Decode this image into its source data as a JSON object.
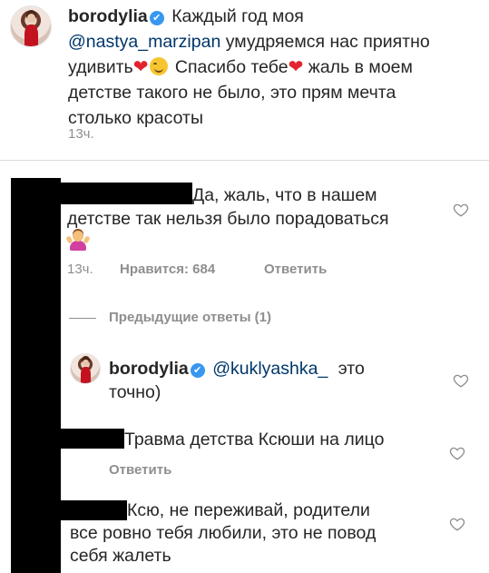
{
  "caption": {
    "username": "borodylia",
    "verified_glyph": "✔",
    "line1_text": "Каждый год моя",
    "mention": "@nastya_marzipan",
    "line2_after_mention": "умудряемся нас приятно",
    "line3_a": "удивить",
    "line3_b": "Спасибо тебе",
    "line3_c": "жаль в моем",
    "line4": "детстве такого не было, это прям мечта",
    "line5": "столько красоты",
    "time": "13ч."
  },
  "comment1": {
    "line1": "Да, жаль, что в нашем",
    "line2": "детстве так нельзя было порадоваться",
    "time": "13ч.",
    "likes": "Нравится: 684",
    "reply": "Ответить"
  },
  "replies_toggle": {
    "label": "Предыдущие ответы (1)"
  },
  "reply1": {
    "username": "borodylia",
    "verified_glyph": "✔",
    "mention": "@kuklyashka_",
    "line1_after": "это",
    "line2": "точно)"
  },
  "comment2": {
    "line1": "Травма детства Ксюши на лицо",
    "reply": "Ответить"
  },
  "comment3": {
    "line1": "Ксю, не переживай, родители",
    "line2": "все ровно тебя любили, это не повод",
    "line3": "себя жалеть"
  },
  "icons": {
    "heart_outline": "heart-outline-icon",
    "heart_emoji": "red-heart-emoji",
    "heart_char": "❤"
  },
  "colors": {
    "text": "#262626",
    "secondary": "#8e8e8e",
    "mention": "#00376b",
    "verified": "#3897f0",
    "heart": "#e3222f"
  }
}
